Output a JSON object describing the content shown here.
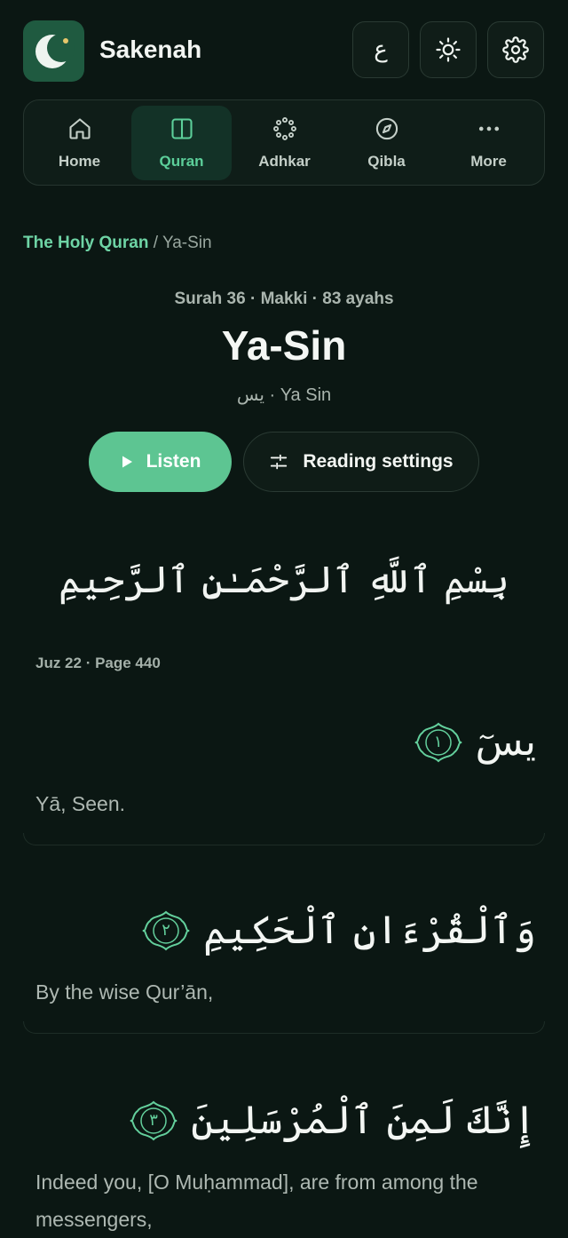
{
  "app": {
    "name": "Sakenah"
  },
  "header": {
    "lang_label": "ع"
  },
  "nav": {
    "items": [
      {
        "label": "Home",
        "icon": "home-icon"
      },
      {
        "label": "Quran",
        "icon": "book-open-icon",
        "active": true
      },
      {
        "label": "Adhkar",
        "icon": "prayer-beads-icon"
      },
      {
        "label": "Qibla",
        "icon": "compass-icon"
      },
      {
        "label": "More",
        "icon": "more-dots-icon"
      }
    ]
  },
  "breadcrumb": {
    "root": "The Holy Quran",
    "separator": "/",
    "current": "Ya-Sin"
  },
  "surah": {
    "meta": "Surah 36 · Makki · 83 ayahs",
    "title": "Ya-Sin",
    "subtitle": "يس · Ya Sin"
  },
  "actions": {
    "listen": "Listen",
    "reading_settings": "Reading settings"
  },
  "basmala": "بِسْمِ ٱللَّهِ ٱلرَّحْمَـٰنِ ٱلرَّحِيمِ",
  "location": "Juz 22 · Page 440",
  "verses": [
    {
      "arabic": "يسٓ",
      "number": "١",
      "translation": "Yā, Seen."
    },
    {
      "arabic": "وَٱلْقُرْءَانِ ٱلْحَكِيمِ",
      "number": "٢",
      "translation": "By the wise Qur’ān,"
    },
    {
      "arabic": "إِنَّكَ لَمِنَ ٱلْمُرْسَلِينَ",
      "number": "٣",
      "translation": "Indeed you, [O Muḥammad], are from among the messengers,"
    }
  ],
  "colors": {
    "background": "#0b1713",
    "accent": "#5dc592",
    "brand": "#1f5a40"
  }
}
